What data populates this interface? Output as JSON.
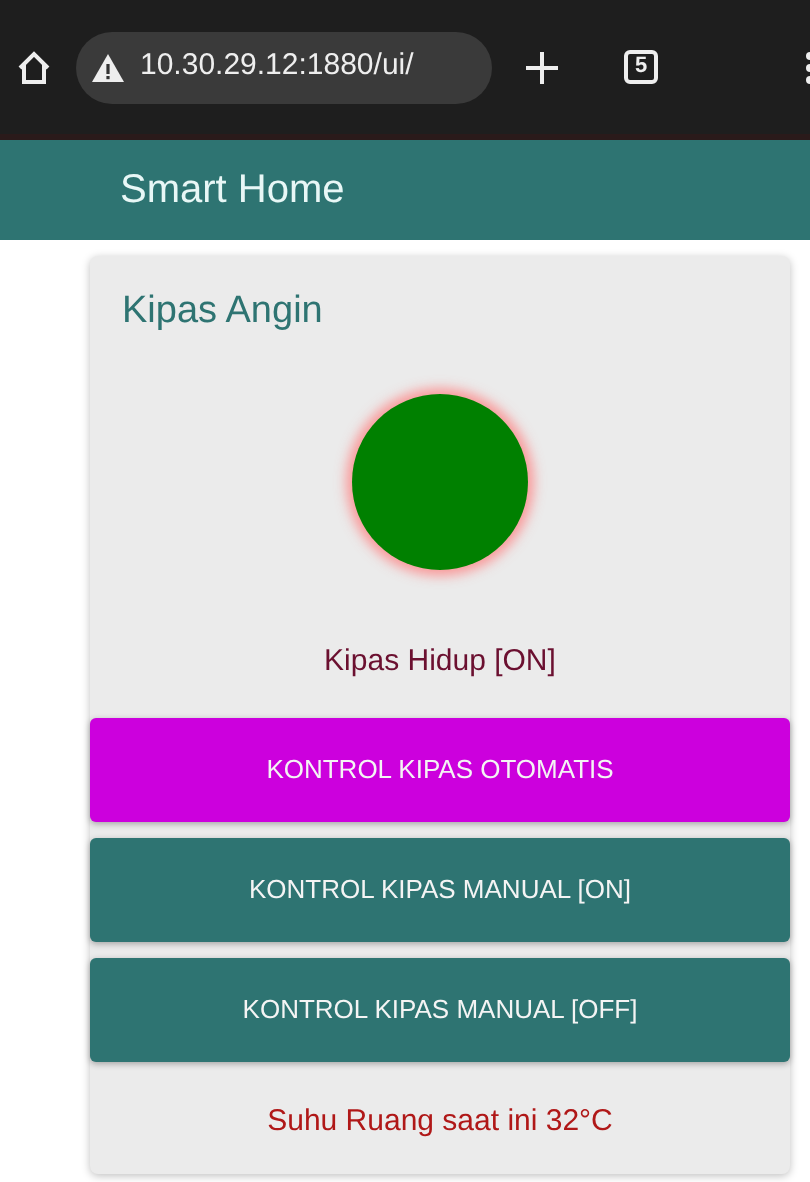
{
  "browser": {
    "url": "10.30.29.12:1880/ui/",
    "tab_count": "5"
  },
  "header": {
    "title": "Smart Home"
  },
  "card": {
    "title": "Kipas Angin",
    "indicator": {
      "color": "#008000"
    },
    "status": "Kipas Hidup [ON]",
    "buttons": [
      {
        "label": "KONTROL KIPAS OTOMATIS",
        "color": "#cc00dd"
      },
      {
        "label": "KONTROL KIPAS MANUAL [ON]",
        "color": "#2e7472"
      },
      {
        "label": "KONTROL KIPAS MANUAL [OFF]",
        "color": "#2e7472"
      }
    ],
    "temperature": "Suhu Ruang saat ini 32°C"
  }
}
